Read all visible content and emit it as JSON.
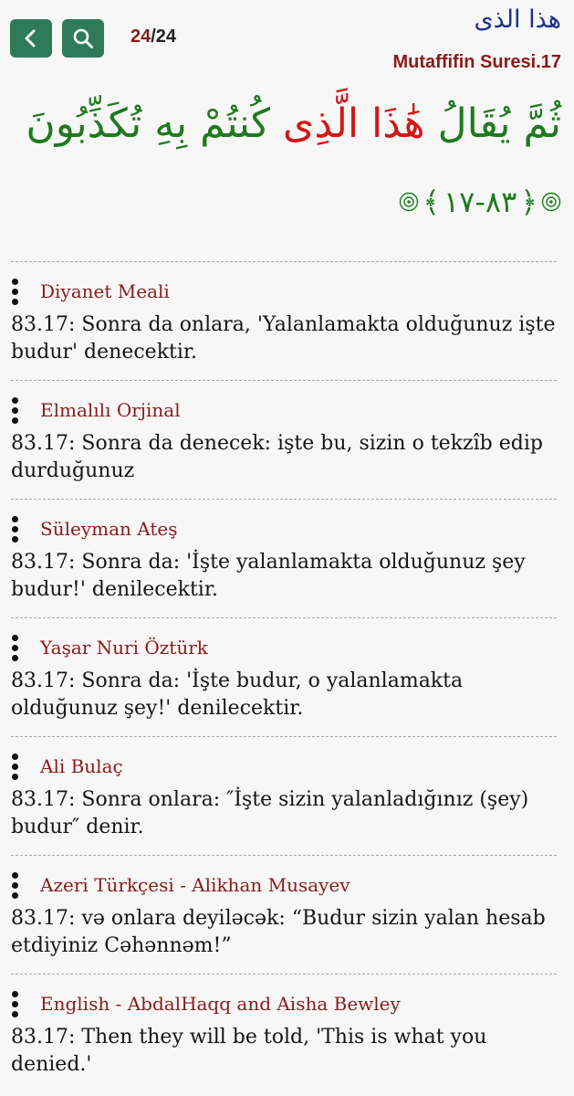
{
  "header": {
    "back_icon": "chevron-left-icon",
    "search_icon": "search-icon",
    "page_current": "24",
    "page_total": "/24",
    "arabic_title": "هذا الذى",
    "surah_title": "Mutaffifin Suresi.17",
    "accent_color": "#2f7a5a"
  },
  "verse": {
    "arabic_before": "ثُمَّ يُقَالُ",
    "arabic_highlight": "هَٰذَا الَّذِى",
    "arabic_after": "كُنتُمْ بِهِ تُكَذِّبُونَ",
    "number": "٨٣-١٧"
  },
  "translations": [
    {
      "name": "Diyanet Meali",
      "text": "83.17: Sonra da onlara, 'Yalanlamakta olduğunuz işte budur' denecektir."
    },
    {
      "name": "Elmalılı Orjinal",
      "text": "83.17: Sonra da denecek: işte bu, sizin o tekzîb edip durduğunuz"
    },
    {
      "name": "Süleyman Ateş",
      "text": "83.17: Sonra da: 'İşte yalanlamakta olduğunuz şey budur!' denilecektir."
    },
    {
      "name": "Yaşar Nuri Öztürk",
      "text": "83.17: Sonra da: 'İşte budur, o yalanlamakta olduğunuz şey!' denilecektir."
    },
    {
      "name": "Ali Bulaç",
      "text": "83.17: Sonra onlara: ″İşte sizin yalanladığınız (şey) budur″ denir."
    },
    {
      "name": "Azeri Türkçesi - Alikhan Musayev",
      "text": "83.17: və onlara deyiləcək: “Budur sizin yalan hesab etdiyiniz Cəhənnəm!”"
    },
    {
      "name": "English - AbdalHaqq and Aisha Bewley",
      "text": "83.17: Then they will be told, 'This is what you denied.'"
    }
  ]
}
